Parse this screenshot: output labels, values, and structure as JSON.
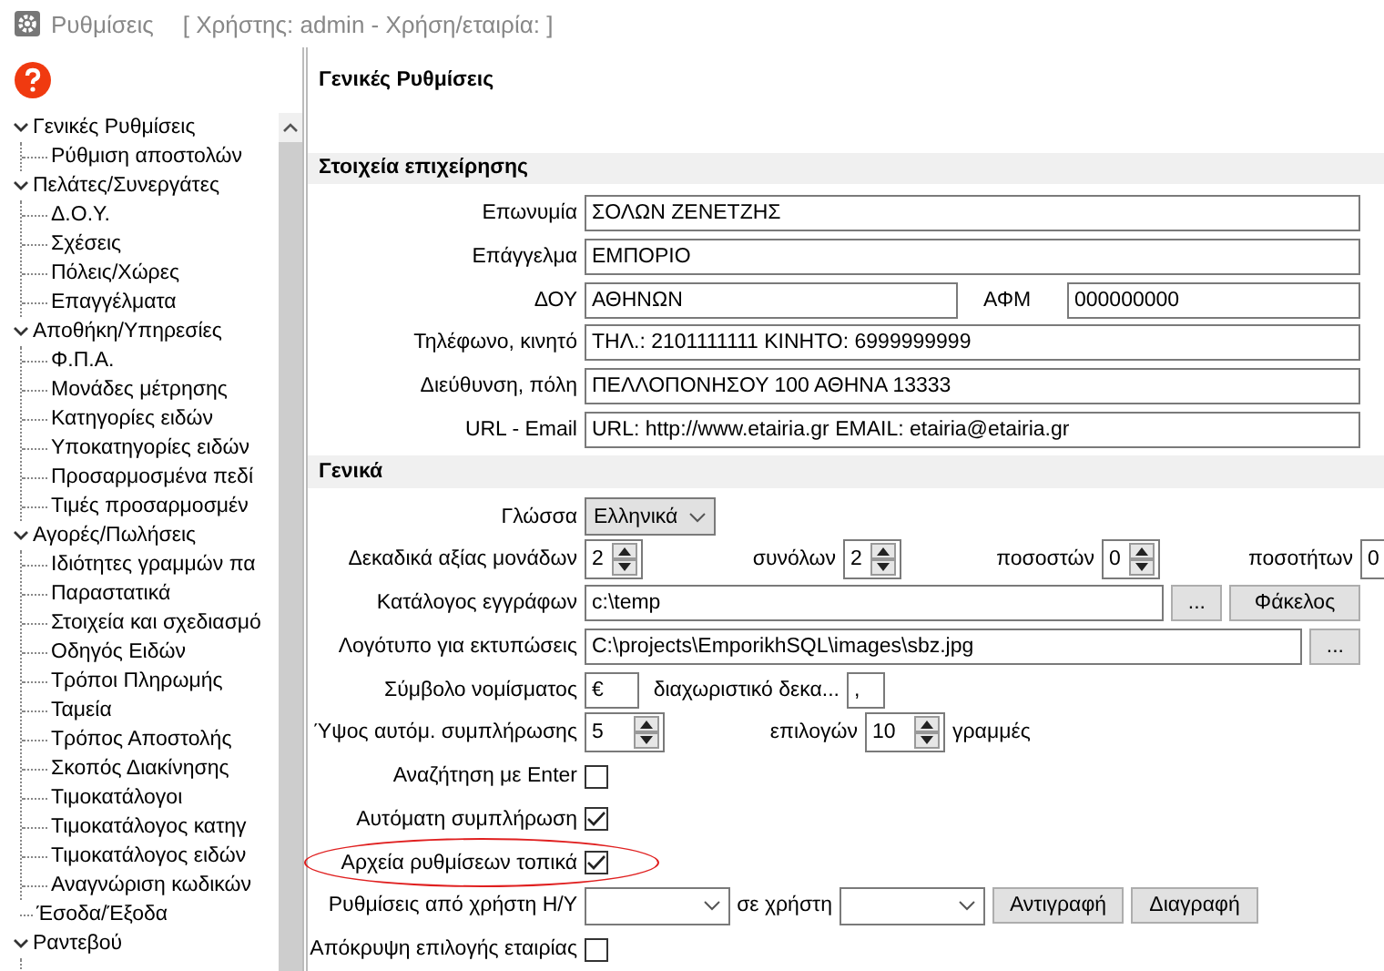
{
  "window": {
    "title": "Ρυθμίσεις",
    "user_info": "[ Χρήστης: admin - Χρήση/εταιρία: ]"
  },
  "page_title": "Γενικές Ρυθμίσεις",
  "tree": [
    {
      "label": "Γενικές Ρυθμίσεις",
      "expanded": true,
      "children": [
        {
          "label": "Ρύθμιση αποστολών"
        }
      ]
    },
    {
      "label": "Πελάτες/Συνεργάτες",
      "expanded": true,
      "children": [
        {
          "label": "Δ.Ο.Υ."
        },
        {
          "label": "Σχέσεις"
        },
        {
          "label": "Πόλεις/Χώρες"
        },
        {
          "label": "Επαγγέλματα"
        }
      ]
    },
    {
      "label": "Αποθήκη/Υπηρεσίες",
      "expanded": true,
      "children": [
        {
          "label": "Φ.Π.Α."
        },
        {
          "label": "Μονάδες μέτρησης"
        },
        {
          "label": "Κατηγορίες ειδών"
        },
        {
          "label": "Υποκατηγορίες ειδών"
        },
        {
          "label": "Προσαρμοσμένα πεδί"
        },
        {
          "label": "Τιμές προσαρμοσμέν"
        }
      ]
    },
    {
      "label": "Αγορές/Πωλήσεις",
      "expanded": true,
      "children": [
        {
          "label": "Ιδιότητες γραμμών πα"
        },
        {
          "label": "Παραστατικά"
        },
        {
          "label": "Στοιχεία και σχεδιασμό"
        },
        {
          "label": "Οδηγός Ειδών"
        },
        {
          "label": "Τρόποι Πληρωμής"
        },
        {
          "label": "Ταμεία"
        },
        {
          "label": "Τρόπος Αποστολής"
        },
        {
          "label": "Σκοπός Διακίνησης"
        },
        {
          "label": "Τιμοκατάλογοι"
        },
        {
          "label": "Τιμοκατάλογος κατηγ"
        },
        {
          "label": "Τιμοκατάλογος ειδών"
        },
        {
          "label": "Αναγνώριση κωδικών"
        }
      ]
    },
    {
      "label": "Έσοδα/Έξοδα"
    },
    {
      "label": "Ραντεβού",
      "expanded": true
    }
  ],
  "business": {
    "title": "Στοιχεία επιχείρησης",
    "rows": [
      {
        "label": "Επωνυμία",
        "value": "ΣΟΛΩΝ ΖΕΝΕΤΖΗΣ"
      },
      {
        "label": "Επάγγελμα",
        "value": "ΕΜΠΟΡΙΟ"
      },
      {
        "label": "ΔΟΥ",
        "value": "ΑΘΗΝΩΝ",
        "label2": "ΑΦΜ",
        "value2": "000000000"
      },
      {
        "label": "Τηλέφωνο, κινητό",
        "value": "ΤΗΛ.: 2101111111 ΚΙΝΗΤΟ: 6999999999"
      },
      {
        "label": "Διεύθυνση, πόλη",
        "value": "ΠΕΛΛΟΠΟΝΗΣΟΥ 100 ΑΘΗΝΑ 13333"
      },
      {
        "label": "URL - Email",
        "value": "URL: http://www.etairia.gr EMAIL: etairia@etairia.gr"
      }
    ]
  },
  "general": {
    "title": "Γενικά",
    "rows": [
      {
        "kind": "select",
        "label": "Γλώσσα",
        "value": "Ελληνικά"
      },
      {
        "kind": "spinners",
        "items": [
          {
            "label": "Δεκαδικά αξίας μονάδων",
            "value": "2"
          },
          {
            "label": "συνόλων",
            "value": "2"
          },
          {
            "label": "ποσοστών",
            "value": "0"
          },
          {
            "label": "ποσοτήτων",
            "value": "0"
          }
        ]
      },
      {
        "kind": "path",
        "label": "Κατάλογος εγγράφων",
        "value": "c:\\temp",
        "buttons": [
          "...",
          "Φάκελος"
        ]
      },
      {
        "kind": "path",
        "label": "Λογότυπο για εκτυπώσεις",
        "value": "C:\\projects\\EmporikhSQL\\images\\sbz.jpg",
        "buttons": [
          "..."
        ]
      },
      {
        "kind": "pair",
        "label": "Σύμβολο νομίσματος",
        "value": "€",
        "label2": "διαχωριστικό δεκα...",
        "value2": ","
      },
      {
        "kind": "spinners",
        "items": [
          {
            "label": "Ύψος αυτόμ. συμπλήρωσης",
            "value": "5"
          },
          {
            "label": "επιλογών",
            "value": "10"
          }
        ],
        "suffix": "γραμμές"
      },
      {
        "kind": "checkbox",
        "label": "Αναζήτηση με Enter",
        "checked": false,
        "highlighted": false
      },
      {
        "kind": "checkbox",
        "label": "Αυτόματη συμπλήρωση",
        "checked": true,
        "highlighted": false
      },
      {
        "kind": "checkbox",
        "label": "Αρχεία ρυθμίσεων τοπικά",
        "checked": true,
        "highlighted": true
      },
      {
        "kind": "copy",
        "label": "Ρυθμίσεις από χρήστη Η/Υ",
        "label2": "σε χρήστη",
        "buttons": [
          "Αντιγραφή",
          "Διαγραφή"
        ]
      },
      {
        "kind": "checkbox",
        "label": "Απόκρυψη επιλογής εταιρίας",
        "checked": false,
        "highlighted": false
      }
    ]
  }
}
